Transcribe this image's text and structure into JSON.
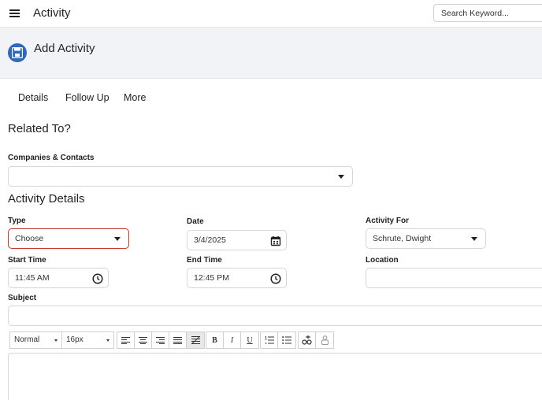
{
  "topbar": {
    "title": "Activity",
    "search_placeholder": "Search Keyword..."
  },
  "header": {
    "title": "Add Activity",
    "icon": "save-icon",
    "accent": "#2f67c0"
  },
  "tabs": [
    {
      "label": "Details"
    },
    {
      "label": "Follow Up"
    },
    {
      "label": "More"
    }
  ],
  "related": {
    "section_title": "Related To?",
    "companies_label": "Companies & Contacts",
    "companies_value": ""
  },
  "details": {
    "section_title": "Activity Details",
    "type_label": "Type",
    "type_value": "Choose",
    "date_label": "Date",
    "date_value": "3/4/2025",
    "activity_for_label": "Activity For",
    "activity_for_value": "Schrute, Dwight",
    "start_time_label": "Start Time",
    "start_time_value": "11:45 AM",
    "end_time_label": "End Time",
    "end_time_value": "12:45 PM",
    "location_label": "Location",
    "location_value": "",
    "subject_label": "Subject",
    "subject_value": ""
  },
  "editor_toolbar": {
    "format_value": "Normal",
    "size_value": "16px",
    "bold": "B",
    "italic": "I",
    "underline": "U"
  },
  "colors": {
    "error_border": "#c0392b",
    "header_band": "#f2f3f7"
  }
}
